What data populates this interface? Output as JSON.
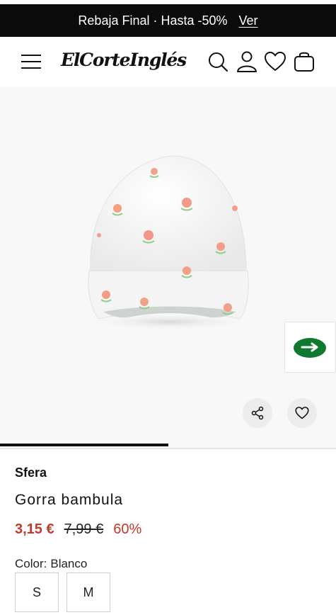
{
  "promo": {
    "text": "Rebaja Final · Hasta -50%",
    "link": "Ver"
  },
  "header": {
    "logo": "ElCorteInglés",
    "icons": [
      "menu-icon",
      "search-icon",
      "user-icon",
      "heart-icon",
      "bag-icon"
    ]
  },
  "gallery": {
    "image_subject": "white baseball cap with flower print",
    "progress": 0.5,
    "side_widget_icon": "green-arrow-icon",
    "actions": [
      "share-icon",
      "heart-icon"
    ]
  },
  "product": {
    "brand": "Sfera",
    "title": "Gorra bambula",
    "price_current": "3,15 €",
    "price_original": "7,99 €",
    "discount": "60%",
    "color_label": "Color:",
    "color_value": "Blanco",
    "sizes": [
      "S",
      "M"
    ]
  },
  "colors": {
    "promo_bg": "#0b0b0b",
    "price_accent": "#c23a2b",
    "widget_green": "#0f7a2e"
  }
}
